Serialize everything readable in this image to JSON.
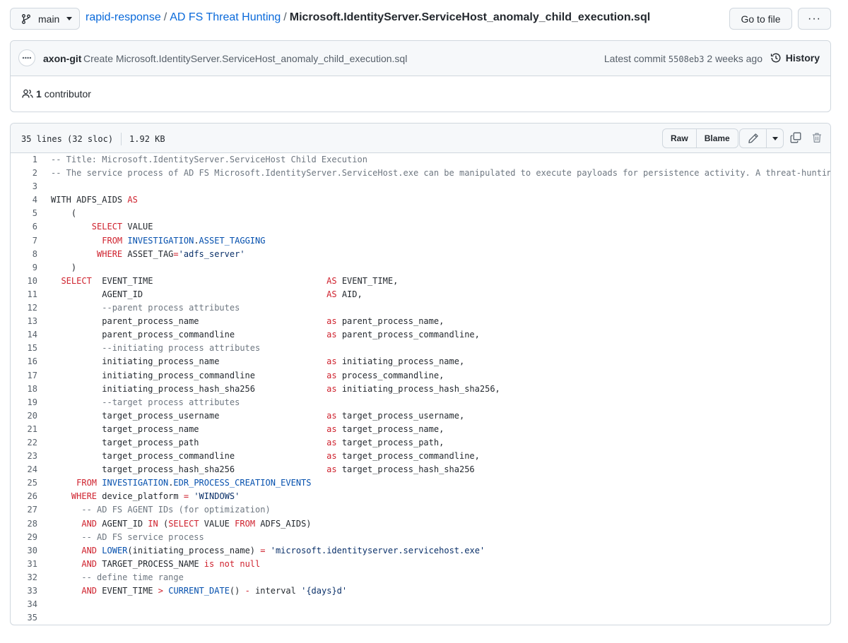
{
  "topbar": {
    "branch": "main",
    "breadcrumb": {
      "repo": "rapid-response",
      "sep1": "/",
      "folder": "AD FS Threat Hunting",
      "sep2": "/",
      "file": "Microsoft.IdentityServer.ServiceHost_anomaly_child_execution.sql"
    },
    "go_to_file": "Go to file",
    "more": "···"
  },
  "commit": {
    "author": "axon-git",
    "message": "Create Microsoft.IdentityServer.ServiceHost_anomaly_child_execution.sql",
    "latest_label": "Latest commit",
    "sha": "5508eb3",
    "time": "2 weeks ago",
    "history_label": "History",
    "contributors_count": "1",
    "contributors_label": "contributor"
  },
  "file": {
    "lines_info": "35 lines (32 sloc)",
    "size": "1.92 KB",
    "raw_label": "Raw",
    "blame_label": "Blame"
  },
  "code_lines": [
    [
      [
        "c",
        "-- Title: Microsoft.IdentityServer.ServiceHost Child Execution"
      ]
    ],
    [
      [
        "c",
        "-- The service process of AD FS Microsoft.IdentityServer.ServiceHost.exe can be manipulated to execute payloads for persistence activity. A threat-hunting thesis"
      ]
    ],
    [],
    [
      [
        "t",
        "WITH ADFS_AIDS "
      ],
      [
        "k",
        "AS"
      ]
    ],
    [
      [
        "t",
        "    ("
      ]
    ],
    [
      [
        "t",
        "        "
      ],
      [
        "k",
        "SELECT"
      ],
      [
        "t",
        " VALUE"
      ]
    ],
    [
      [
        "t",
        "          "
      ],
      [
        "k",
        "FROM"
      ],
      [
        "t",
        " "
      ],
      [
        "f",
        "INVESTIGATION"
      ],
      [
        "t",
        "."
      ],
      [
        "f",
        "ASSET_TAGGING"
      ]
    ],
    [
      [
        "t",
        "         "
      ],
      [
        "k",
        "WHERE"
      ],
      [
        "t",
        " ASSET_TAG"
      ],
      [
        "k",
        "="
      ],
      [
        "s",
        "'adfs_server'"
      ]
    ],
    [
      [
        "t",
        "    )"
      ]
    ],
    [
      [
        "t",
        "  "
      ],
      [
        "k",
        "SELECT"
      ],
      [
        "t",
        "  EVENT_TIME                                  "
      ],
      [
        "k",
        "AS"
      ],
      [
        "t",
        " EVENT_TIME,"
      ]
    ],
    [
      [
        "t",
        "          AGENT_ID                                    "
      ],
      [
        "k",
        "AS"
      ],
      [
        "t",
        " AID,"
      ]
    ],
    [
      [
        "t",
        "          "
      ],
      [
        "c",
        "--parent process attributes"
      ]
    ],
    [
      [
        "t",
        "          parent_process_name                         "
      ],
      [
        "k",
        "as"
      ],
      [
        "t",
        " parent_process_name,"
      ]
    ],
    [
      [
        "t",
        "          parent_process_commandline                  "
      ],
      [
        "k",
        "as"
      ],
      [
        "t",
        " parent_process_commandline,"
      ]
    ],
    [
      [
        "t",
        "          "
      ],
      [
        "c",
        "--initiating process attributes"
      ]
    ],
    [
      [
        "t",
        "          initiating_process_name                     "
      ],
      [
        "k",
        "as"
      ],
      [
        "t",
        " initiating_process_name,"
      ]
    ],
    [
      [
        "t",
        "          initiating_process_commandline              "
      ],
      [
        "k",
        "as"
      ],
      [
        "t",
        " process_commandline,"
      ]
    ],
    [
      [
        "t",
        "          initiating_process_hash_sha256              "
      ],
      [
        "k",
        "as"
      ],
      [
        "t",
        " initiating_process_hash_sha256,"
      ]
    ],
    [
      [
        "t",
        "          "
      ],
      [
        "c",
        "--target process attributes"
      ]
    ],
    [
      [
        "t",
        "          target_process_username                     "
      ],
      [
        "k",
        "as"
      ],
      [
        "t",
        " target_process_username,"
      ]
    ],
    [
      [
        "t",
        "          target_process_name                         "
      ],
      [
        "k",
        "as"
      ],
      [
        "t",
        " target_process_name,"
      ]
    ],
    [
      [
        "t",
        "          target_process_path                         "
      ],
      [
        "k",
        "as"
      ],
      [
        "t",
        " target_process_path,"
      ]
    ],
    [
      [
        "t",
        "          target_process_commandline                  "
      ],
      [
        "k",
        "as"
      ],
      [
        "t",
        " target_process_commandline,"
      ]
    ],
    [
      [
        "t",
        "          target_process_hash_sha256                  "
      ],
      [
        "k",
        "as"
      ],
      [
        "t",
        " target_process_hash_sha256"
      ]
    ],
    [
      [
        "t",
        "     "
      ],
      [
        "k",
        "FROM"
      ],
      [
        "t",
        " "
      ],
      [
        "f",
        "INVESTIGATION"
      ],
      [
        "t",
        "."
      ],
      [
        "f",
        "EDR_PROCESS_CREATION_EVENTS"
      ]
    ],
    [
      [
        "t",
        "    "
      ],
      [
        "k",
        "WHERE"
      ],
      [
        "t",
        " device_platform "
      ],
      [
        "k",
        "="
      ],
      [
        "t",
        " "
      ],
      [
        "s",
        "'WINDOWS'"
      ]
    ],
    [
      [
        "t",
        "      "
      ],
      [
        "c",
        "-- AD FS AGENT IDs (for optimization)"
      ]
    ],
    [
      [
        "t",
        "      "
      ],
      [
        "k",
        "AND"
      ],
      [
        "t",
        " AGENT_ID "
      ],
      [
        "k",
        "IN"
      ],
      [
        "t",
        " ("
      ],
      [
        "k",
        "SELECT"
      ],
      [
        "t",
        " VALUE "
      ],
      [
        "k",
        "FROM"
      ],
      [
        "t",
        " ADFS_AIDS)"
      ]
    ],
    [
      [
        "t",
        "      "
      ],
      [
        "c",
        "-- AD FS service process"
      ]
    ],
    [
      [
        "t",
        "      "
      ],
      [
        "k",
        "AND"
      ],
      [
        "t",
        " "
      ],
      [
        "f",
        "LOWER"
      ],
      [
        "t",
        "(initiating_process_name) "
      ],
      [
        "k",
        "="
      ],
      [
        "t",
        " "
      ],
      [
        "s",
        "'microsoft.identityserver.servicehost.exe'"
      ]
    ],
    [
      [
        "t",
        "      "
      ],
      [
        "k",
        "AND"
      ],
      [
        "t",
        " TARGET_PROCESS_NAME "
      ],
      [
        "k",
        "is not null"
      ]
    ],
    [
      [
        "t",
        "      "
      ],
      [
        "c",
        "-- define time range"
      ]
    ],
    [
      [
        "t",
        "      "
      ],
      [
        "k",
        "AND"
      ],
      [
        "t",
        " EVENT_TIME "
      ],
      [
        "k",
        ">"
      ],
      [
        "t",
        " "
      ],
      [
        "f",
        "CURRENT_DATE"
      ],
      [
        "t",
        "() "
      ],
      [
        "k",
        "-"
      ],
      [
        "t",
        " interval "
      ],
      [
        "s",
        "'{days}d'"
      ]
    ],
    [],
    []
  ]
}
